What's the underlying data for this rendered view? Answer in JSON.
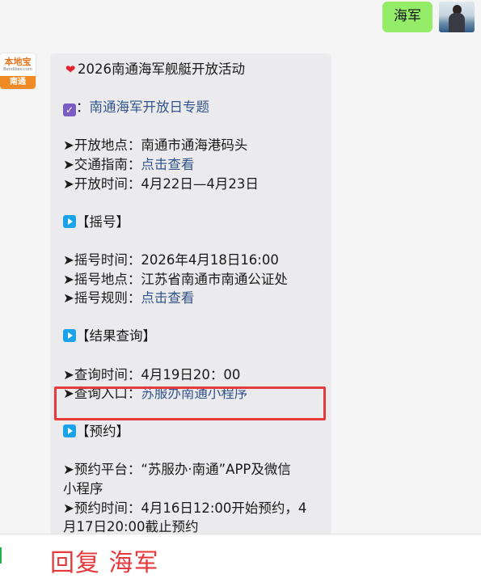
{
  "user_message": {
    "text": "海军"
  },
  "bot": {
    "avatar": {
      "brand": "本地宝",
      "domain": "Bendibao.com",
      "city": "南通"
    },
    "message": {
      "title": "2026南通海军舰艇开放活动",
      "topic_prefix": "：",
      "topic_link": "南通海军开放日专题",
      "arrow": "➤",
      "open_location_label": "开放地点：",
      "open_location_value": "南通市通海港码头",
      "traffic_label": "交通指南：",
      "traffic_link": "点击查看",
      "open_time_label": "开放时间：",
      "open_time_value": "4月22日—4月23日",
      "lottery_section": "【摇号】",
      "lottery_time_label": "摇号时间：",
      "lottery_time_value": "2026年4月18日16:00",
      "lottery_place_label": "摇号地点：",
      "lottery_place_value": "江苏省南通市南通公证处",
      "lottery_rule_label": "摇号规则：",
      "lottery_rule_link": "点击查看",
      "result_section": "【结果查询】",
      "query_time_label": "查询时间：",
      "query_time_value": "4月19日20：00",
      "query_entry_label": "查询入口：",
      "query_entry_link": "苏服办南通小程序",
      "booking_section": "【预约】",
      "booking_platform_label": "预约平台：",
      "booking_platform_value": "“苏服办·南通”APP及微信",
      "booking_platform_value_cont": "小程序",
      "booking_time_label": "预约时间：",
      "booking_time_value": "4月16日12:00开始预约，4",
      "booking_time_value_cont": "月17日20:00截止预约"
    }
  },
  "bottom_bar": {
    "reply_hint": "回复 海军"
  },
  "colors": {
    "accent_red": "#e5393b",
    "link_blue": "#34558b",
    "user_bubble_green": "#95ec69",
    "bubble_gray": "#ebebed"
  },
  "icons": [
    "heart-icon",
    "checkbox-icon",
    "play-icon"
  ]
}
